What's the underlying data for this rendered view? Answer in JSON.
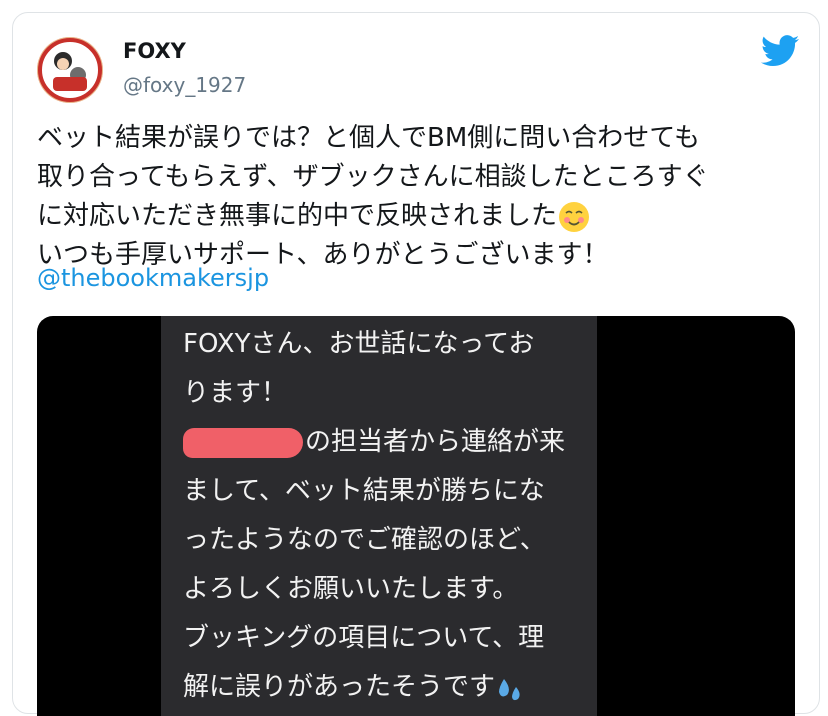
{
  "tweet": {
    "author_name": "FOXY",
    "author_handle": "@foxy_1927",
    "text_lines": [
      "ベット結果が誤りでは？と個人でBM側に問い合わせても",
      "取り合ってもらえず、ザブックさんに相談したところすぐ",
      "に対応いただき無事に的中で反映されました",
      "いつも手厚いサポート、ありがとうございます！"
    ],
    "mention": "@thebookmakersjp",
    "icons": [
      "avatar",
      "twitter-bird-icon",
      "smiling-face-emoji",
      "sweat-droplets-emoji"
    ],
    "colors": {
      "mention": "#1b95e0",
      "brand_bird": "#1da1f2",
      "redaction": "#f06068"
    }
  },
  "screenshot_message": {
    "lines": [
      "FOXYさん、お世話になってお",
      "ります！",
      "の担当者から連絡が来",
      "まして、ベット結果が勝ちにな",
      "ったようなのでご確認のほど、",
      "よろしくお願いいたします。",
      "ブッキングの項目について、理",
      "解に誤りがあったそうです"
    ]
  }
}
